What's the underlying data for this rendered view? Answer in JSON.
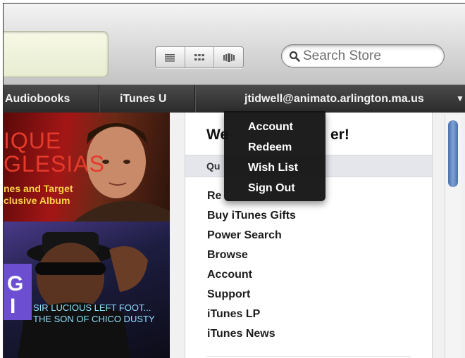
{
  "toolbar": {
    "view_buttons": [
      "list-view-icon",
      "grid-view-icon",
      "coverflow-view-icon"
    ],
    "search": {
      "placeholder": "Search Store",
      "icon": "magnifier-icon"
    }
  },
  "nav": {
    "items": [
      {
        "label": "Audiobooks"
      },
      {
        "label": "iTunes U"
      }
    ],
    "account_label": "jtidwell@animato.arlington.ma.us",
    "account_arrow": "▼"
  },
  "promo1": {
    "title_line1": "IQUE",
    "title_line2": "GLESIAS",
    "caption_line1": "nes and Target",
    "caption_line2": "clusive Album"
  },
  "promo2": {
    "logo_text_1": "G",
    "logo_text_2": "I",
    "caption_line1": "SIR LUCIOUS LEFT FOOT...",
    "caption_line2": "THE SON OF CHICO DUSTY"
  },
  "panel": {
    "welcome_prefix": "We",
    "welcome_suffix": "er!",
    "quick_links_prefix": "Qu",
    "links": [
      {
        "label": "Re"
      },
      {
        "label": "Buy iTunes Gifts"
      },
      {
        "label": "Power Search"
      },
      {
        "label": "Browse"
      },
      {
        "label": "Account"
      },
      {
        "label": "Support"
      },
      {
        "label": "iTunes LP"
      },
      {
        "label": "iTunes News"
      }
    ]
  },
  "dropdown": {
    "items": [
      {
        "label": "Account"
      },
      {
        "label": "Redeem"
      },
      {
        "label": "Wish List"
      },
      {
        "label": "Sign Out"
      }
    ]
  },
  "colors": {
    "nav_bg": "#2f2f2f",
    "dropdown_bg": "#121212",
    "scroll_thumb": "#5f84bf",
    "lcd": "#eef1d8"
  }
}
